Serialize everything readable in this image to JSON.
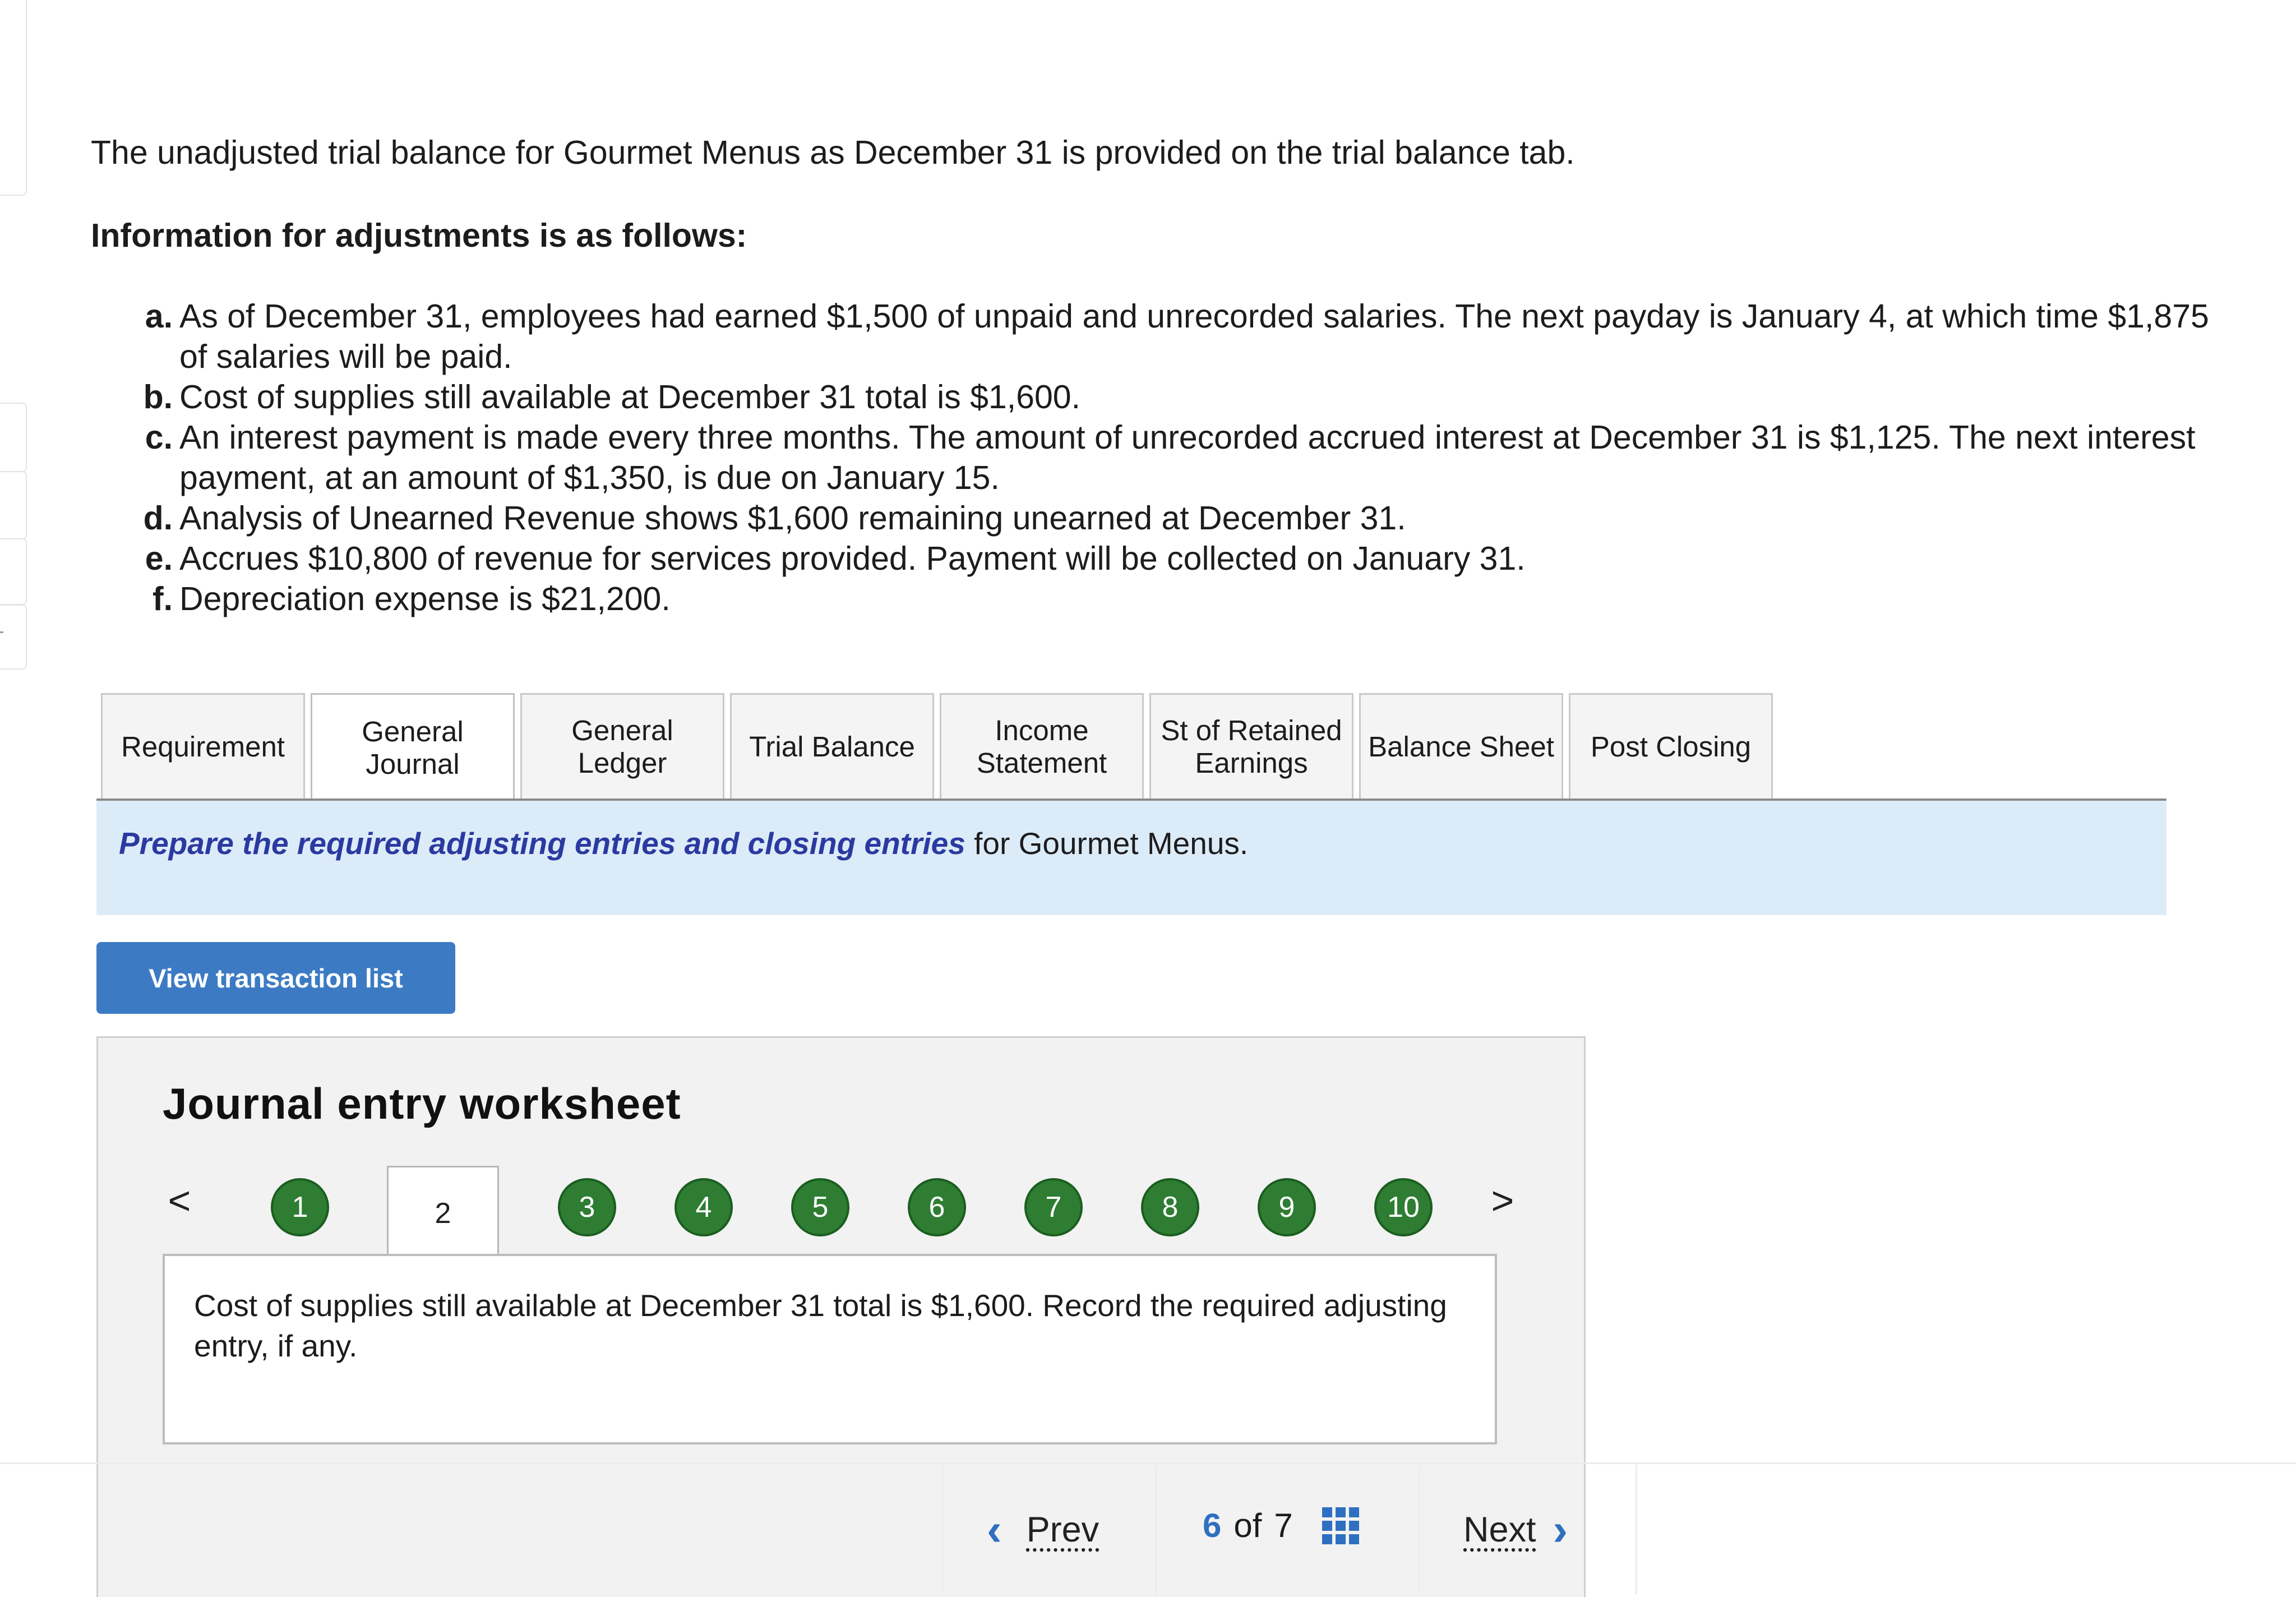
{
  "intro": "The unadjusted trial balance for Gourmet Menus as December 31 is provided on the trial balance tab.",
  "adjustments_heading": "Information for adjustments is as follows:",
  "adjustments": [
    {
      "letter": "a.",
      "text": "As of December 31, employees had earned $1,500 of unpaid and unrecorded salaries. The next payday is January 4, at which time $1,875 of salaries will be paid."
    },
    {
      "letter": "b.",
      "text": "Cost of supplies still available at December 31 total is $1,600."
    },
    {
      "letter": "c.",
      "text": "An interest payment is made every three months. The amount of unrecorded accrued interest at December 31 is $1,125. The next interest payment, at an amount of $1,350, is due on January 15."
    },
    {
      "letter": "d.",
      "text": "Analysis of Unearned Revenue shows $1,600 remaining unearned at December 31."
    },
    {
      "letter": "e.",
      "text": "Accrues $10,800 of revenue for services provided. Payment will be collected on January 31."
    },
    {
      "letter": "f.",
      "text": "Depreciation expense is $21,200."
    }
  ],
  "tabs": [
    {
      "label": "Requirement"
    },
    {
      "label": "General Journal"
    },
    {
      "label": "General Ledger"
    },
    {
      "label": "Trial Balance"
    },
    {
      "label": "Income Statement"
    },
    {
      "label": "St of Retained Earnings"
    },
    {
      "label": "Balance Sheet"
    },
    {
      "label": "Post Closing"
    }
  ],
  "active_tab": "General Journal",
  "banner": {
    "emphasis": "Prepare the required adjusting entries and closing entries",
    "rest": " for Gourmet Menus."
  },
  "view_transaction_button": "View transaction list",
  "worksheet": {
    "title": "Journal entry worksheet",
    "steps": [
      "1",
      "2",
      "3",
      "4",
      "5",
      "6",
      "7",
      "8",
      "9",
      "10"
    ],
    "active_step": "2",
    "prev_arrow": "<",
    "next_arrow": ">",
    "prompt": "Cost of supplies still available at December 31 total is $1,600. Record the required adjusting entry, if any."
  },
  "footer": {
    "prev_label": "Prev",
    "next_label": "Next",
    "current_page": "6",
    "of_label": "of",
    "total_pages": "7",
    "prev_chevron": "‹",
    "next_chevron": "›"
  },
  "colors": {
    "accent_blue": "#3c7bc4",
    "step_green": "#2e7d32",
    "banner_bg": "#dcebf8",
    "banner_emphasis": "#2b3aa0"
  }
}
